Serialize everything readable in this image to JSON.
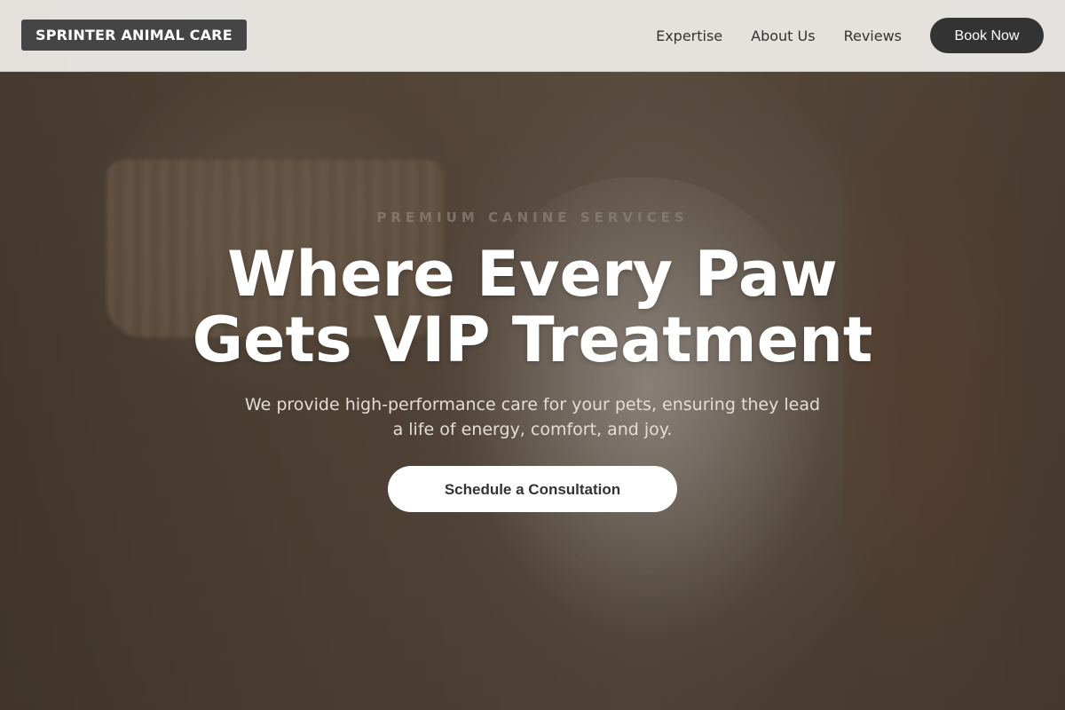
{
  "brand": {
    "logo_text": "SPRINTER ANIMAL CARE"
  },
  "nav": {
    "links": [
      {
        "label": "Expertise"
      },
      {
        "label": "About Us"
      },
      {
        "label": "Reviews"
      }
    ],
    "book_label": "Book Now"
  },
  "hero": {
    "eyebrow": "PREMIUM CANINE SERVICES",
    "headline_line1": "Where Every Paw",
    "headline_line2": "Gets VIP Treatment",
    "subtext": "We provide high-performance care for your pets, ensuring they lead a life of energy, comfort, and joy.",
    "cta_label": "Schedule a Consultation"
  },
  "colors": {
    "nav_bg": "#eeece9",
    "logo_bg": "#454545",
    "button_dark": "#333333",
    "cta_bg": "#ffffff"
  }
}
